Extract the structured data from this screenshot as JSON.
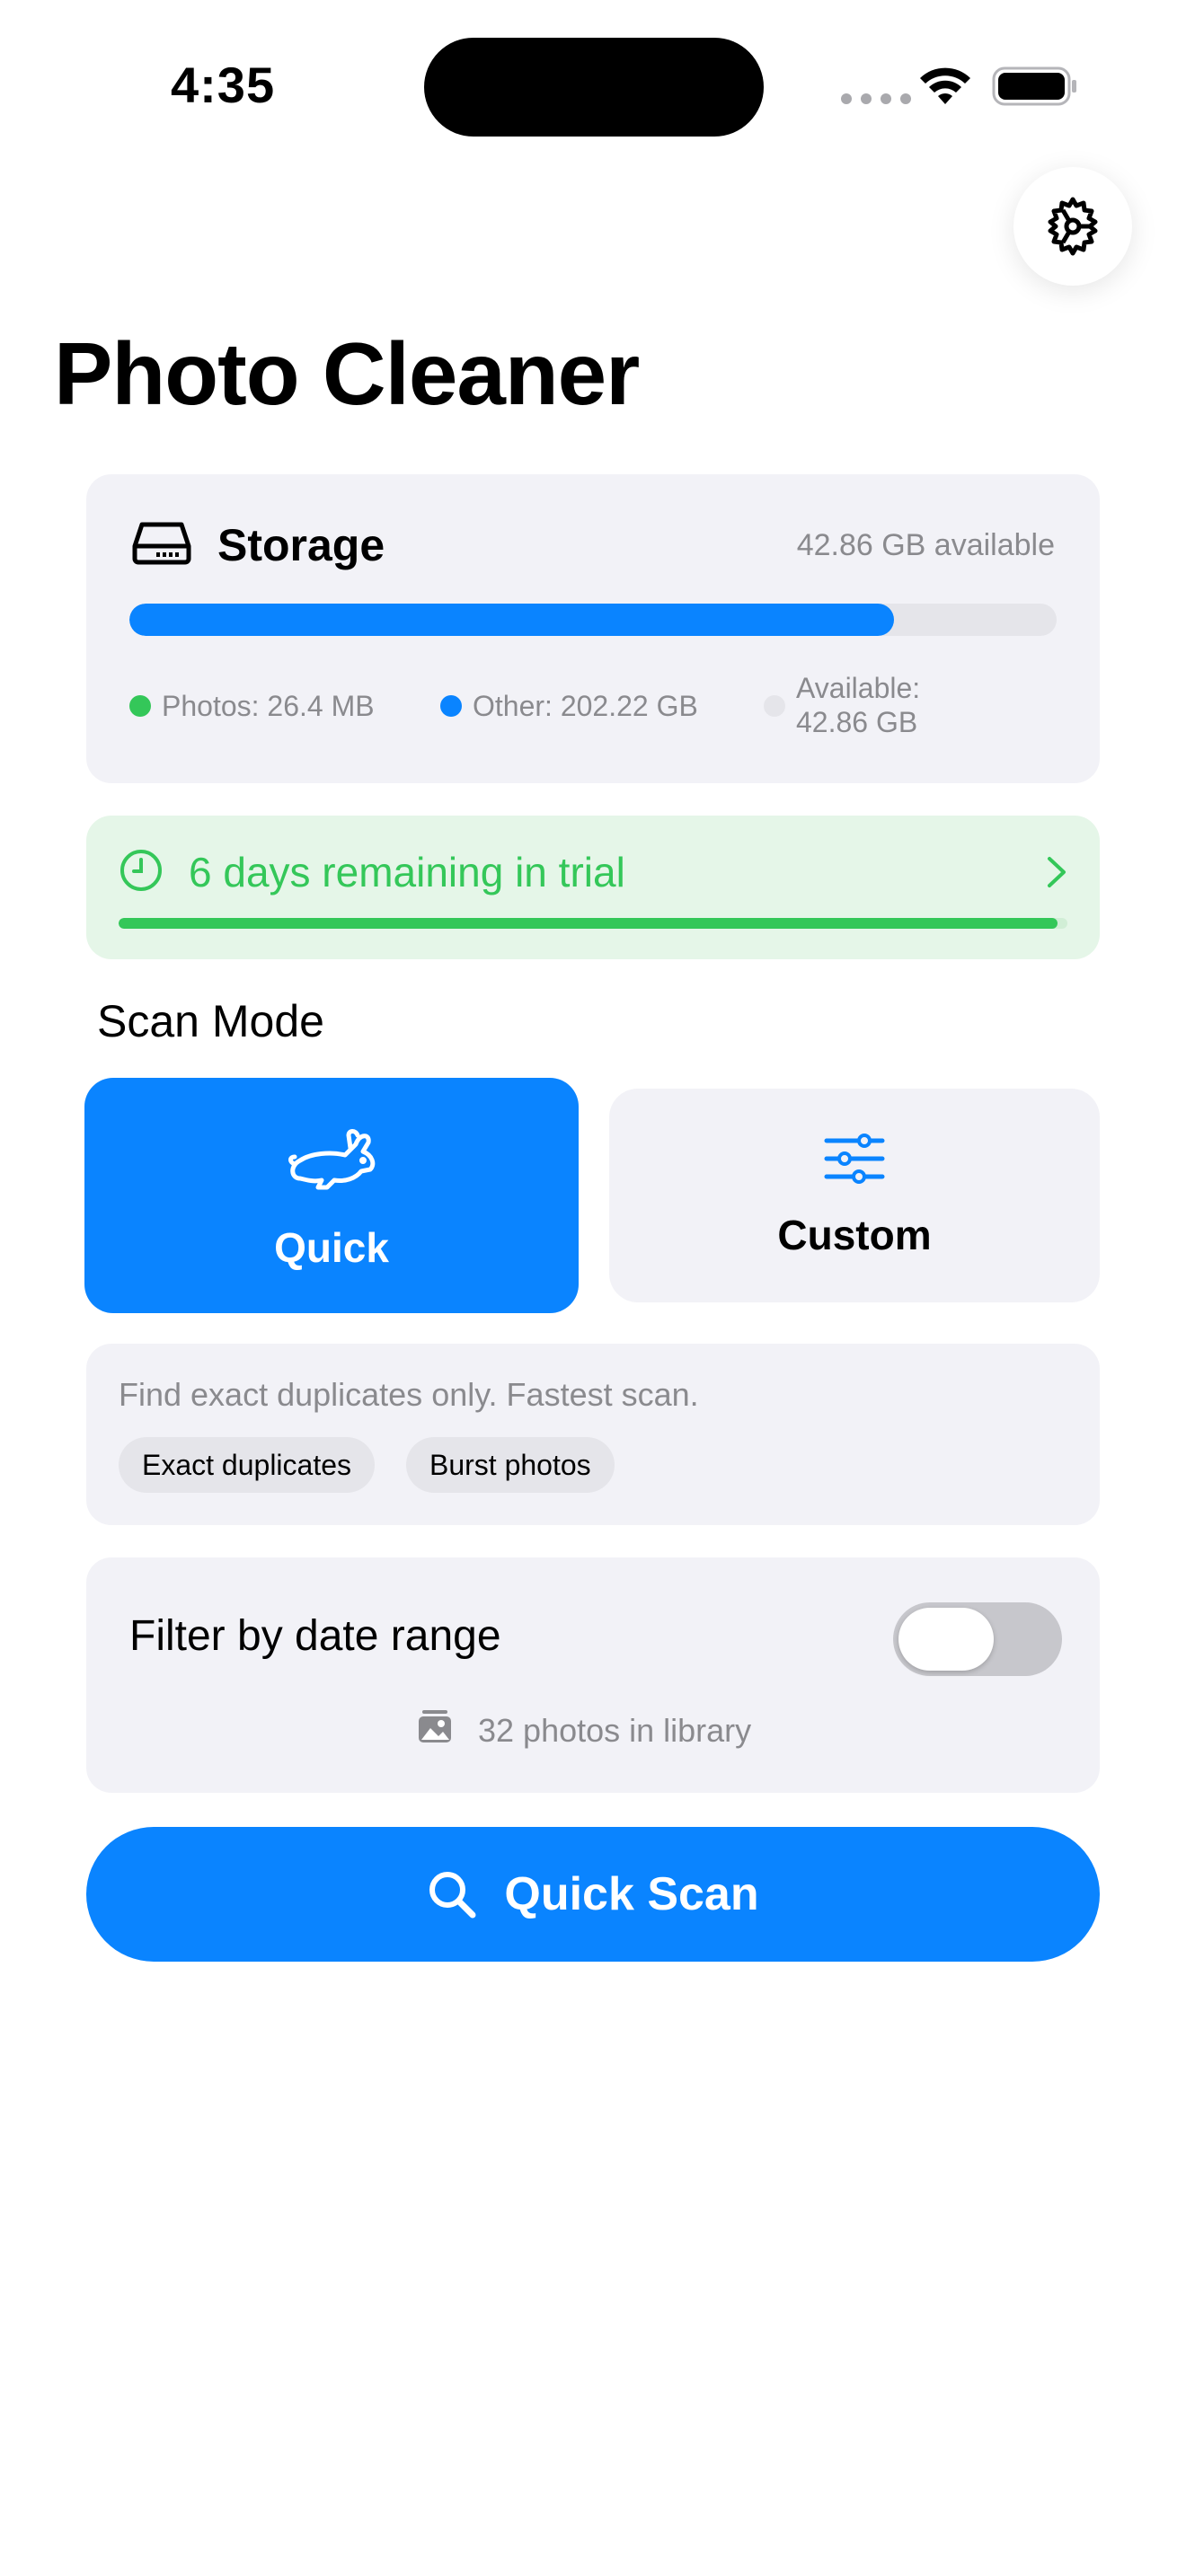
{
  "status_bar": {
    "time": "4:35"
  },
  "page": {
    "title": "Photo Cleaner"
  },
  "storage": {
    "title": "Storage",
    "available_summary": "42.86 GB available",
    "used_fraction": 0.825,
    "legend": {
      "photos": "Photos: 26.4 MB",
      "other": "Other: 202.22 GB",
      "available_line1": "Available:",
      "available_line2": "42.86 GB"
    }
  },
  "trial": {
    "text": "6 days remaining in trial",
    "progress_fraction": 0.99
  },
  "scan_mode": {
    "title": "Scan Mode",
    "quick_label": "Quick",
    "custom_label": "Custom",
    "description": "Find exact duplicates only. Fastest scan.",
    "chips": [
      "Exact duplicates",
      "Burst photos"
    ]
  },
  "filter": {
    "label": "Filter by date range",
    "toggle_on": false,
    "library_count_text": "32 photos in library"
  },
  "action": {
    "scan_label": "Quick Scan"
  },
  "colors": {
    "accent": "#0a84ff",
    "success": "#34c759",
    "card_bg": "#f2f2f7",
    "trial_bg": "#e5f6e8"
  }
}
